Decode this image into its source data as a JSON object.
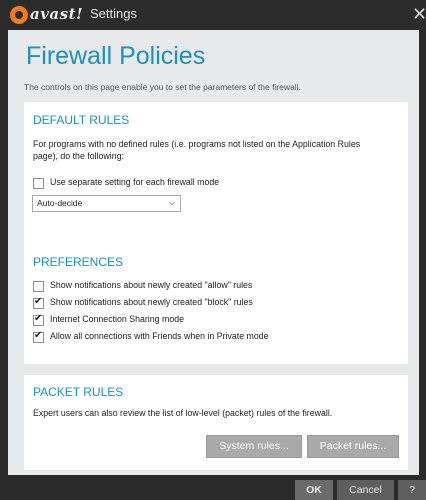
{
  "window": {
    "logo_text": "avast!",
    "title": "Settings",
    "close_glyph": "✕"
  },
  "page": {
    "title": "Firewall Policies",
    "description": "The controls on this page enable you to set the parameters of the firewall."
  },
  "default_rules": {
    "title": "DEFAULT RULES",
    "description_line1": "For programs with no defined rules (i.e. programs not listed on the Application Rules",
    "description_line2": "page), do the following:",
    "separate_setting": {
      "label": "Use separate setting for each firewall mode",
      "checked": false
    },
    "mode_select": {
      "value": "Auto-decide"
    }
  },
  "preferences": {
    "title": "PREFERENCES",
    "options": [
      {
        "label": "Show notifications about newly created \"allow\" rules",
        "checked": false
      },
      {
        "label": "Show notifications about newly created \"block\" rules",
        "checked": true
      },
      {
        "label": "Internet Connection Sharing mode",
        "checked": true
      },
      {
        "label": "Allow all connections with Friends when in Private mode",
        "checked": true
      }
    ]
  },
  "packet_rules": {
    "title": "PACKET RULES",
    "description": "Expert users can also review the list of low-level (packet) rules of the firewall.",
    "system_rules_button": "System rules...",
    "packet_rules_button": "Packet rules..."
  },
  "footer": {
    "ok": "OK",
    "cancel": "Cancel",
    "help": "?"
  },
  "colors": {
    "accent": "#1b8fc6",
    "logo_orange": "#f07b1e",
    "titlebar": "#2c2c2c",
    "content_bg": "#e8e9ea"
  }
}
